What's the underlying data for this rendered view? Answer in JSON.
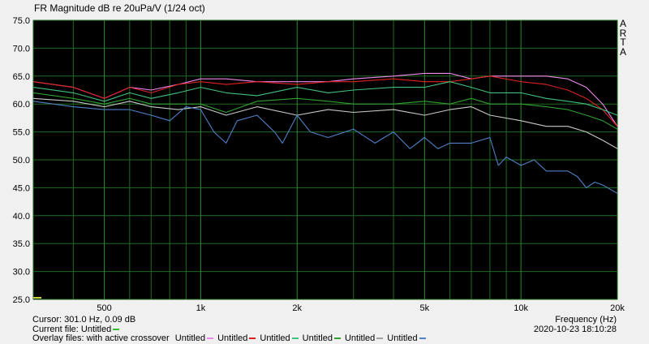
{
  "window": {
    "title": "FR Magnitude dB re 20uPa/V (1/24 oct)",
    "logo_letters": [
      "A",
      "R",
      "T",
      "A"
    ]
  },
  "chart_data": {
    "type": "line",
    "title": "FR Magnitude dB re 20uPa/V (1/24 oct)",
    "xlabel": "Frequency (Hz)",
    "ylabel": "",
    "xscale": "log",
    "xlim": [
      300,
      20000
    ],
    "ylim": [
      25,
      75
    ],
    "x_tick_labels": [
      {
        "value": 500,
        "label": "500"
      },
      {
        "value": 1000,
        "label": "1k"
      },
      {
        "value": 2000,
        "label": "2k"
      },
      {
        "value": 5000,
        "label": "5k"
      },
      {
        "value": 10000,
        "label": "10k"
      },
      {
        "value": 20000,
        "label": "20k"
      }
    ],
    "y_ticks": [
      25,
      30,
      35,
      40,
      45,
      50,
      55,
      60,
      65,
      70,
      75
    ],
    "y_tick_labels": [
      "25.0",
      "30.0",
      "35.0",
      "40.0",
      "45.0",
      "50.0",
      "55.0",
      "60.0",
      "65.0",
      "70.0",
      "75.0"
    ],
    "grid": true,
    "background": "#000000",
    "grid_color": "#1f6b1f",
    "series": [
      {
        "color": "#ee88ee",
        "points": [
          [
            300,
            64
          ],
          [
            400,
            63
          ],
          [
            500,
            61
          ],
          [
            600,
            63
          ],
          [
            700,
            62.5
          ],
          [
            850,
            63.5
          ],
          [
            1000,
            64.5
          ],
          [
            1200,
            64.5
          ],
          [
            1500,
            64
          ],
          [
            2000,
            64
          ],
          [
            2500,
            64
          ],
          [
            3000,
            64.5
          ],
          [
            4000,
            65
          ],
          [
            5000,
            65.5
          ],
          [
            6000,
            65.5
          ],
          [
            7000,
            64.5
          ],
          [
            8000,
            65
          ],
          [
            10000,
            65
          ],
          [
            12000,
            65
          ],
          [
            14000,
            64.5
          ],
          [
            16000,
            63
          ],
          [
            18000,
            60
          ],
          [
            20000,
            56
          ]
        ]
      },
      {
        "color": "#e02020",
        "points": [
          [
            300,
            64
          ],
          [
            400,
            63
          ],
          [
            500,
            61
          ],
          [
            600,
            63
          ],
          [
            700,
            62
          ],
          [
            850,
            63.5
          ],
          [
            1000,
            64
          ],
          [
            1200,
            63.5
          ],
          [
            1500,
            64
          ],
          [
            2000,
            63.5
          ],
          [
            2500,
            64
          ],
          [
            3000,
            64
          ],
          [
            4000,
            64.5
          ],
          [
            5000,
            64
          ],
          [
            6000,
            64
          ],
          [
            7000,
            64.5
          ],
          [
            8000,
            65
          ],
          [
            10000,
            64
          ],
          [
            12000,
            63.5
          ],
          [
            14000,
            62.5
          ],
          [
            16000,
            61
          ],
          [
            18000,
            59
          ],
          [
            20000,
            56
          ]
        ]
      },
      {
        "color": "#40c080",
        "points": [
          [
            300,
            63
          ],
          [
            400,
            62
          ],
          [
            500,
            60.5
          ],
          [
            600,
            62
          ],
          [
            700,
            61
          ],
          [
            850,
            62
          ],
          [
            1000,
            63
          ],
          [
            1200,
            62
          ],
          [
            1500,
            61.5
          ],
          [
            2000,
            63
          ],
          [
            2500,
            62
          ],
          [
            3000,
            62.5
          ],
          [
            4000,
            63
          ],
          [
            5000,
            63
          ],
          [
            6000,
            64
          ],
          [
            7000,
            63
          ],
          [
            8000,
            62
          ],
          [
            10000,
            62
          ],
          [
            12000,
            61
          ],
          [
            14000,
            60.5
          ],
          [
            16000,
            60
          ],
          [
            18000,
            59
          ],
          [
            20000,
            58
          ]
        ]
      },
      {
        "color": "#30a030",
        "points": [
          [
            300,
            62
          ],
          [
            400,
            61
          ],
          [
            500,
            60
          ],
          [
            600,
            61
          ],
          [
            700,
            60
          ],
          [
            850,
            60
          ],
          [
            1000,
            60
          ],
          [
            1200,
            58.5
          ],
          [
            1500,
            60.5
          ],
          [
            2000,
            61
          ],
          [
            2500,
            60.5
          ],
          [
            3000,
            60
          ],
          [
            4000,
            60
          ],
          [
            5000,
            60.5
          ],
          [
            6000,
            60
          ],
          [
            7000,
            61
          ],
          [
            8000,
            60
          ],
          [
            10000,
            60
          ],
          [
            12000,
            59.5
          ],
          [
            14000,
            59
          ],
          [
            16000,
            58
          ],
          [
            18000,
            57
          ],
          [
            20000,
            55.5
          ]
        ]
      },
      {
        "color": "#c8c8c8",
        "points": [
          [
            300,
            61
          ],
          [
            400,
            60.5
          ],
          [
            500,
            59.5
          ],
          [
            600,
            60.5
          ],
          [
            700,
            59.5
          ],
          [
            850,
            59
          ],
          [
            1000,
            59.5
          ],
          [
            1200,
            58
          ],
          [
            1500,
            59.5
          ],
          [
            2000,
            58
          ],
          [
            2500,
            59
          ],
          [
            3000,
            58.5
          ],
          [
            4000,
            59
          ],
          [
            5000,
            58
          ],
          [
            6000,
            59
          ],
          [
            7000,
            59.5
          ],
          [
            8000,
            58
          ],
          [
            10000,
            57
          ],
          [
            12000,
            56
          ],
          [
            14000,
            56
          ],
          [
            16000,
            55
          ],
          [
            18000,
            53.5
          ],
          [
            20000,
            52
          ]
        ]
      },
      {
        "color": "#5080c8",
        "points": [
          [
            300,
            60.5
          ],
          [
            400,
            59.5
          ],
          [
            500,
            59
          ],
          [
            600,
            59
          ],
          [
            700,
            58
          ],
          [
            800,
            57
          ],
          [
            900,
            59.5
          ],
          [
            1000,
            59
          ],
          [
            1100,
            55
          ],
          [
            1200,
            53
          ],
          [
            1300,
            57
          ],
          [
            1500,
            58
          ],
          [
            1700,
            55
          ],
          [
            1800,
            53
          ],
          [
            2000,
            58
          ],
          [
            2200,
            55
          ],
          [
            2500,
            54
          ],
          [
            3000,
            55.5
          ],
          [
            3500,
            53
          ],
          [
            4000,
            55
          ],
          [
            4500,
            52
          ],
          [
            5000,
            54
          ],
          [
            5500,
            52
          ],
          [
            6000,
            53
          ],
          [
            7000,
            53
          ],
          [
            8000,
            54
          ],
          [
            8500,
            49
          ],
          [
            9000,
            50.5
          ],
          [
            10000,
            49
          ],
          [
            11000,
            50
          ],
          [
            12000,
            48
          ],
          [
            14000,
            48
          ],
          [
            15000,
            47
          ],
          [
            16000,
            45
          ],
          [
            17000,
            46
          ],
          [
            18000,
            45.5
          ],
          [
            20000,
            44
          ]
        ]
      }
    ]
  },
  "footer": {
    "cursor": "Cursor: 301.0 Hz, 0.09 dB",
    "current_file_label": "Current file: Untitled",
    "current_file_color": "#30c030",
    "overlay_label": "Overlay files: with active crossover",
    "overlays": [
      {
        "label": "Untitled",
        "color": "#ee88ee"
      },
      {
        "label": "Untitled",
        "color": "#e02020"
      },
      {
        "label": "Untitled",
        "color": "#40c080"
      },
      {
        "label": "Untitled",
        "color": "#30a030"
      },
      {
        "label": "Untitled",
        "color": "#a0a0a0"
      },
      {
        "label": "Untitled",
        "color": "#5080c8"
      }
    ],
    "datetime": "2020-10-23  18:10:28"
  }
}
